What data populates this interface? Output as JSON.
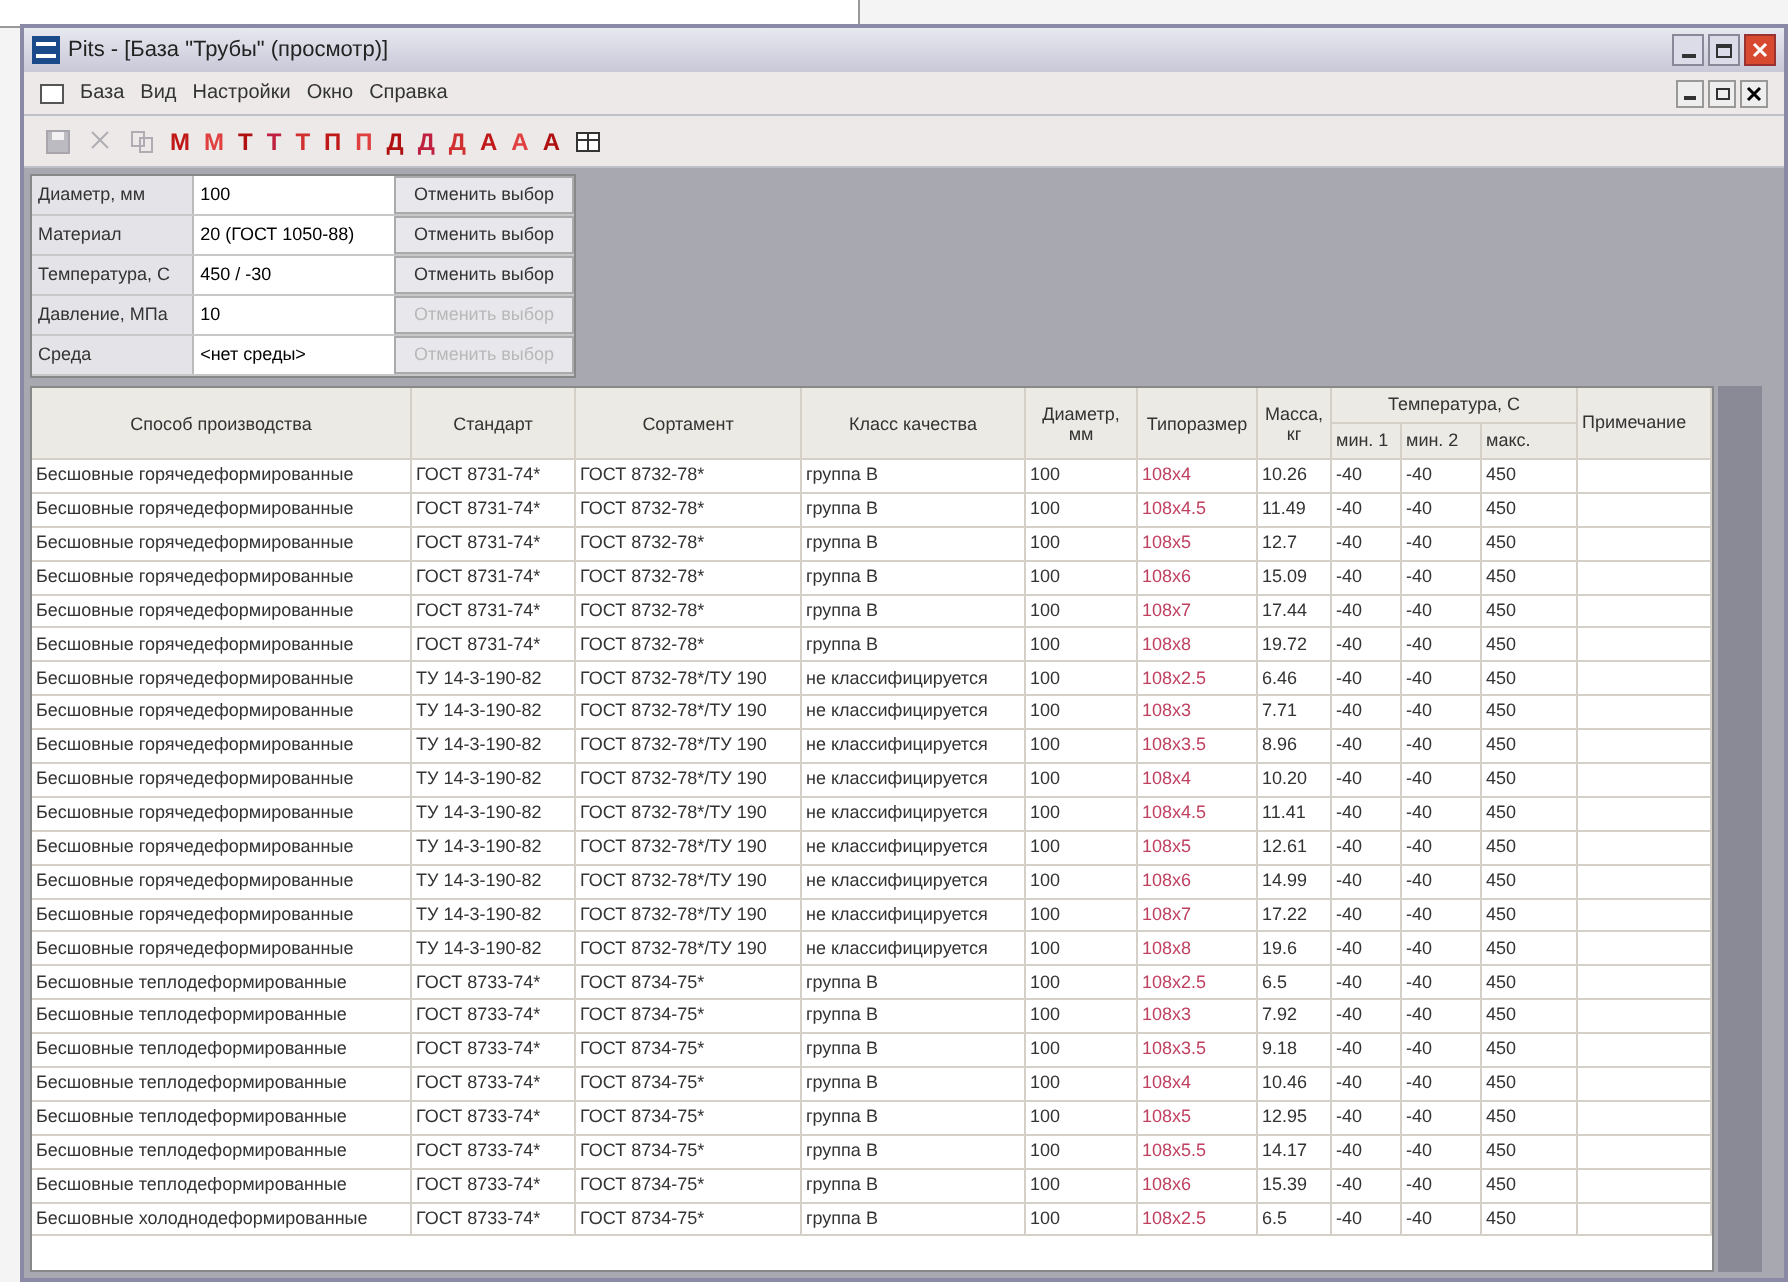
{
  "window": {
    "title": "Pits - [База \"Трубы\" (просмотр)]"
  },
  "menu": [
    "База",
    "Вид",
    "Настройки",
    "Окно",
    "Справка"
  ],
  "toolbar": [
    {
      "kind": "save",
      "disabled": true
    },
    {
      "kind": "cut",
      "disabled": true
    },
    {
      "kind": "copy",
      "disabled": true
    },
    {
      "kind": "letter",
      "label": "М",
      "disabled": false
    },
    {
      "kind": "letter",
      "label": "М",
      "disabled": false
    },
    {
      "kind": "letter",
      "label": "Т",
      "disabled": false
    },
    {
      "kind": "letter",
      "label": "Т",
      "disabled": false
    },
    {
      "kind": "letter",
      "label": "Т",
      "disabled": false
    },
    {
      "kind": "letter",
      "label": "П",
      "disabled": false
    },
    {
      "kind": "letter",
      "label": "П",
      "disabled": false
    },
    {
      "kind": "letter",
      "label": "Д",
      "disabled": false
    },
    {
      "kind": "letter",
      "label": "Д",
      "disabled": false
    },
    {
      "kind": "letter",
      "label": "Д",
      "disabled": false
    },
    {
      "kind": "letter",
      "label": "А",
      "disabled": false
    },
    {
      "kind": "letter",
      "label": "А",
      "disabled": false
    },
    {
      "kind": "letter",
      "label": "А",
      "disabled": false
    },
    {
      "kind": "grid",
      "disabled": false
    }
  ],
  "filters": [
    {
      "label": "Диаметр, мм",
      "value": "100",
      "button": "Отменить выбор",
      "disabled": false
    },
    {
      "label": "Материал",
      "value": "20 (ГОСТ 1050-88)",
      "button": "Отменить выбор",
      "disabled": false
    },
    {
      "label": "Температура, С",
      "value": "450 / -30",
      "button": "Отменить выбор",
      "disabled": false
    },
    {
      "label": "Давление, МПа",
      "value": "10",
      "button": "Отменить выбор",
      "disabled": true
    },
    {
      "label": "Среда",
      "value": "<нет среды>",
      "button": "Отменить выбор",
      "disabled": true
    }
  ],
  "table": {
    "columns": [
      "Способ производства",
      "Стандарт",
      "Сортамент",
      "Класс качества",
      "Диаметр, мм",
      "Типоразмер",
      "Масса, кг"
    ],
    "group": {
      "label": "Температура, С",
      "columns": [
        "мин. 1",
        "мин. 2",
        "макс."
      ]
    },
    "last_column": "Примечание",
    "rows": [
      [
        "Бесшовные горячедеформированные",
        "ГОСТ 8731-74*",
        "ГОСТ 8732-78*",
        "группа В",
        "100",
        "108x4",
        "10.26",
        "-40",
        "-40",
        "450"
      ],
      [
        "Бесшовные горячедеформированные",
        "ГОСТ 8731-74*",
        "ГОСТ 8732-78*",
        "группа В",
        "100",
        "108x4.5",
        "11.49",
        "-40",
        "-40",
        "450"
      ],
      [
        "Бесшовные горячедеформированные",
        "ГОСТ 8731-74*",
        "ГОСТ 8732-78*",
        "группа В",
        "100",
        "108x5",
        "12.7",
        "-40",
        "-40",
        "450"
      ],
      [
        "Бесшовные горячедеформированные",
        "ГОСТ 8731-74*",
        "ГОСТ 8732-78*",
        "группа В",
        "100",
        "108x6",
        "15.09",
        "-40",
        "-40",
        "450"
      ],
      [
        "Бесшовные горячедеформированные",
        "ГОСТ 8731-74*",
        "ГОСТ 8732-78*",
        "группа В",
        "100",
        "108x7",
        "17.44",
        "-40",
        "-40",
        "450"
      ],
      [
        "Бесшовные горячедеформированные",
        "ГОСТ 8731-74*",
        "ГОСТ 8732-78*",
        "группа В",
        "100",
        "108x8",
        "19.72",
        "-40",
        "-40",
        "450"
      ],
      [
        "Бесшовные горячедеформированные",
        "ТУ 14-3-190-82",
        "ГОСТ 8732-78*/ТУ 190",
        "не классифицируется",
        "100",
        "108x2.5",
        "6.46",
        "-40",
        "-40",
        "450"
      ],
      [
        "Бесшовные горячедеформированные",
        "ТУ 14-3-190-82",
        "ГОСТ 8732-78*/ТУ 190",
        "не классифицируется",
        "100",
        "108x3",
        "7.71",
        "-40",
        "-40",
        "450"
      ],
      [
        "Бесшовные горячедеформированные",
        "ТУ 14-3-190-82",
        "ГОСТ 8732-78*/ТУ 190",
        "не классифицируется",
        "100",
        "108x3.5",
        "8.96",
        "-40",
        "-40",
        "450"
      ],
      [
        "Бесшовные горячедеформированные",
        "ТУ 14-3-190-82",
        "ГОСТ 8732-78*/ТУ 190",
        "не классифицируется",
        "100",
        "108x4",
        "10.20",
        "-40",
        "-40",
        "450"
      ],
      [
        "Бесшовные горячедеформированные",
        "ТУ 14-3-190-82",
        "ГОСТ 8732-78*/ТУ 190",
        "не классифицируется",
        "100",
        "108x4.5",
        "11.41",
        "-40",
        "-40",
        "450"
      ],
      [
        "Бесшовные горячедеформированные",
        "ТУ 14-3-190-82",
        "ГОСТ 8732-78*/ТУ 190",
        "не классифицируется",
        "100",
        "108x5",
        "12.61",
        "-40",
        "-40",
        "450"
      ],
      [
        "Бесшовные горячедеформированные",
        "ТУ 14-3-190-82",
        "ГОСТ 8732-78*/ТУ 190",
        "не классифицируется",
        "100",
        "108x6",
        "14.99",
        "-40",
        "-40",
        "450"
      ],
      [
        "Бесшовные горячедеформированные",
        "ТУ 14-3-190-82",
        "ГОСТ 8732-78*/ТУ 190",
        "не классифицируется",
        "100",
        "108x7",
        "17.22",
        "-40",
        "-40",
        "450"
      ],
      [
        "Бесшовные горячедеформированные",
        "ТУ 14-3-190-82",
        "ГОСТ 8732-78*/ТУ 190",
        "не классифицируется",
        "100",
        "108x8",
        "19.6",
        "-40",
        "-40",
        "450"
      ],
      [
        "Бесшовные теплодеформированные",
        "ГОСТ 8733-74*",
        "ГОСТ 8734-75*",
        "группа В",
        "100",
        "108x2.5",
        "6.5",
        "-40",
        "-40",
        "450"
      ],
      [
        "Бесшовные теплодеформированные",
        "ГОСТ 8733-74*",
        "ГОСТ 8734-75*",
        "группа В",
        "100",
        "108x3",
        "7.92",
        "-40",
        "-40",
        "450"
      ],
      [
        "Бесшовные теплодеформированные",
        "ГОСТ 8733-74*",
        "ГОСТ 8734-75*",
        "группа В",
        "100",
        "108x3.5",
        "9.18",
        "-40",
        "-40",
        "450"
      ],
      [
        "Бесшовные теплодеформированные",
        "ГОСТ 8733-74*",
        "ГОСТ 8734-75*",
        "группа В",
        "100",
        "108x4",
        "10.46",
        "-40",
        "-40",
        "450"
      ],
      [
        "Бесшовные теплодеформированные",
        "ГОСТ 8733-74*",
        "ГОСТ 8734-75*",
        "группа В",
        "100",
        "108x5",
        "12.95",
        "-40",
        "-40",
        "450"
      ],
      [
        "Бесшовные теплодеформированные",
        "ГОСТ 8733-74*",
        "ГОСТ 8734-75*",
        "группа В",
        "100",
        "108x5.5",
        "14.17",
        "-40",
        "-40",
        "450"
      ],
      [
        "Бесшовные теплодеформированные",
        "ГОСТ 8733-74*",
        "ГОСТ 8734-75*",
        "группа В",
        "100",
        "108x6",
        "15.39",
        "-40",
        "-40",
        "450"
      ],
      [
        "Бесшовные холоднодеформированные",
        "ГОСТ 8733-74*",
        "ГОСТ 8734-75*",
        "группа В",
        "100",
        "108x2.5",
        "6.5",
        "-40",
        "-40",
        "450"
      ]
    ]
  }
}
